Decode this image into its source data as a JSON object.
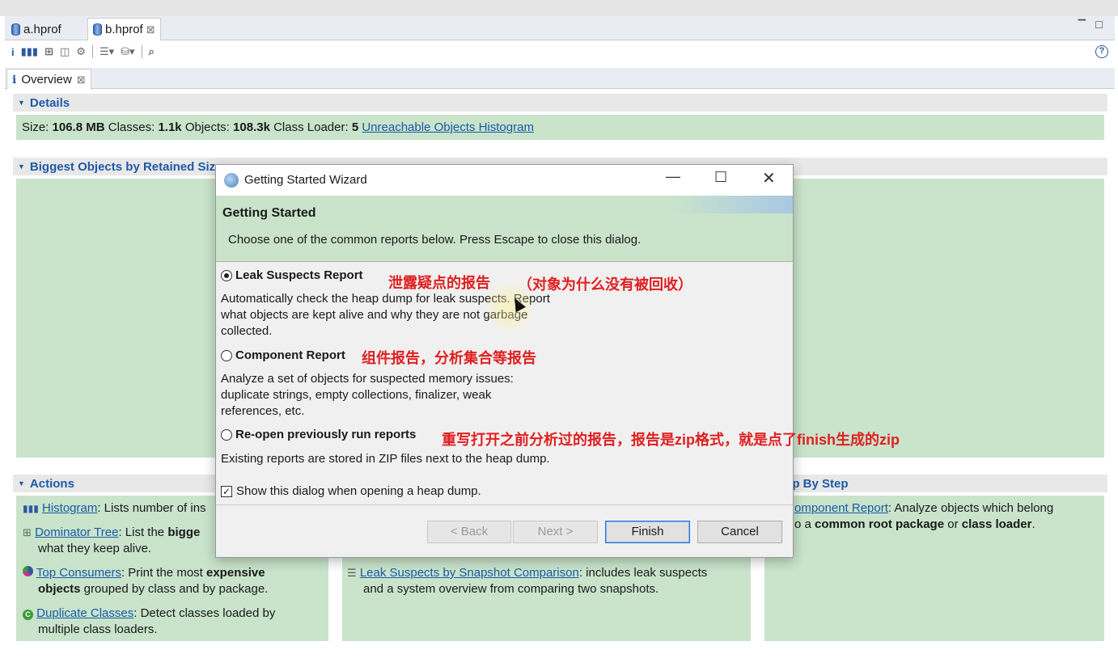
{
  "editor_tabs": [
    {
      "label": "a.hprof",
      "active": false
    },
    {
      "label": "b.hprof",
      "active": true,
      "close": "⊠"
    }
  ],
  "view_tab": {
    "icon": "i",
    "label": "Overview",
    "close": "⊠"
  },
  "details": {
    "heading": "Details",
    "size_label": "Size:",
    "size_value": "106.8 MB",
    "classes_label": "Classes:",
    "classes_value": "1.1k",
    "objects_label": "Objects:",
    "objects_value": "108.3k",
    "loader_label": "Class Loader:",
    "loader_value": "5",
    "link": "Unreachable Objects Histogram"
  },
  "biggest": {
    "heading": "Biggest Objects by Retained Siz"
  },
  "actions": {
    "heading": "Actions",
    "histogram": {
      "link": "Histogram",
      "text": ": Lists number of ins"
    },
    "dominator": {
      "link": "Dominator Tree",
      "text": ": List the ",
      "bold": "bigge",
      "line2": "what they keep alive."
    },
    "top_consumers": {
      "link": "Top Consumers",
      "text": ": Print the most ",
      "bold1": "expensive",
      "bold2": "objects",
      "line2": " grouped by class and by package."
    },
    "duplicate": {
      "link": "Duplicate Classes",
      "text": ": Detect classes loaded by",
      "line2": "multiple class loaders."
    }
  },
  "reports_middle": {
    "link": "Leak Suspects by Snapshot Comparison",
    "text": ": includes leak suspects",
    "line2": "and a system overview from comparing two snapshots."
  },
  "step_by_step": {
    "heading": "ep By Step",
    "link": "omponent Report",
    "text": ": Analyze objects which belong",
    "line2_pre": "o a ",
    "line2_bold": "common root package",
    "line2_mid": " or ",
    "line2_bold2": "class loader",
    "line2_end": "."
  },
  "dialog": {
    "title": "Getting Started Wizard",
    "header_title": "Getting Started",
    "header_sub": "Choose one of the common reports below. Press Escape to close this dialog.",
    "options": [
      {
        "label": "Leak Suspects Report",
        "selected": true,
        "desc1": "Automatically check the heap dump for leak suspects. Report",
        "desc2": "what objects are kept alive and why they are not garbage",
        "desc3": "collected."
      },
      {
        "label": "Component Report",
        "selected": false,
        "desc1": "Analyze a set of objects for suspected memory issues:",
        "desc2": "duplicate strings, empty collections, finalizer, weak",
        "desc3": "references, etc."
      },
      {
        "label": "Re-open previously run reports",
        "selected": false,
        "desc1": "Existing reports are stored in ZIP files next to the heap dump."
      }
    ],
    "checkbox_label": "Show this dialog when opening a heap dump.",
    "checkbox_checked": true,
    "buttons": {
      "back": "< Back",
      "next": "Next >",
      "finish": "Finish",
      "cancel": "Cancel"
    }
  },
  "annotations": {
    "a1": "泄露疑点的报告",
    "a2": "（对象为什么没有被回收）",
    "a3": "组件报告，分析集合等报告",
    "a4": "重写打开之前分析过的报告，报告是zip格式，就是点了finish生成的zip"
  },
  "colors": {
    "panel_green": "#c9e4cb",
    "link_blue": "#1a5aa8",
    "annotation_red": "#e02020"
  }
}
